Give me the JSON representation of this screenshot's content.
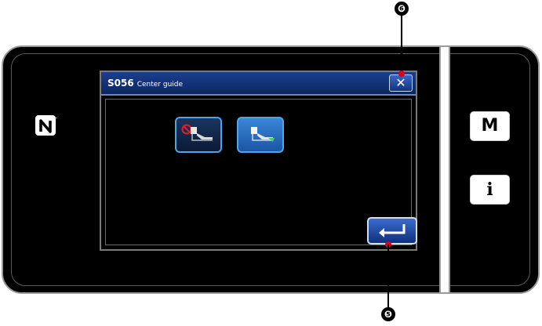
{
  "dialog": {
    "code": "S056",
    "name": "Center guide",
    "close_icon": "close-icon",
    "options": [
      {
        "id": "center-guide-off",
        "icon": "presser-foot-no-guide-icon",
        "selected": false
      },
      {
        "id": "center-guide-on",
        "icon": "presser-foot-guide-icon",
        "selected": true
      }
    ],
    "enter_icon": "enter-icon"
  },
  "side_buttons": {
    "m_label": "M",
    "info_label": "i"
  },
  "callouts": {
    "close_number": "❻",
    "enter_number": "❺"
  },
  "colors": {
    "title_bar": "#1b3f8e",
    "selected_button": "#3c86d8",
    "callout_dot": "#d8001e"
  }
}
